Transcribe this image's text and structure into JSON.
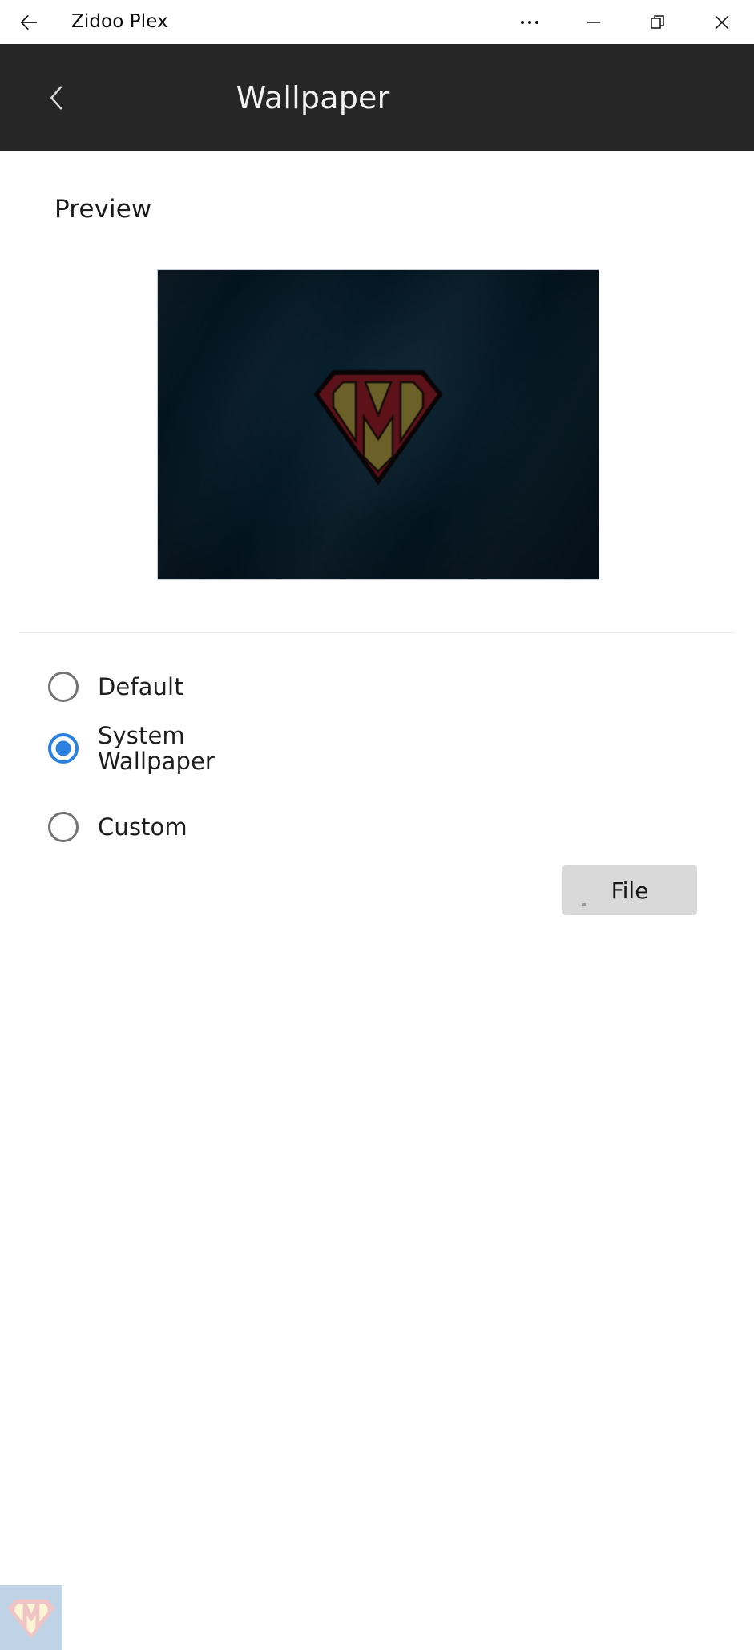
{
  "window": {
    "title": "Zidoo Plex",
    "back_icon": "arrow-left-icon",
    "controls": [
      {
        "name": "more-options-button",
        "glyph": "…",
        "label": "..."
      },
      {
        "name": "minimize-button",
        "glyph": "—",
        "label": "Minimize"
      },
      {
        "name": "restore-button",
        "glyph": "❐",
        "label": "Restore"
      },
      {
        "name": "close-button",
        "glyph": "✕",
        "label": "Close"
      }
    ]
  },
  "header": {
    "title": "Wallpaper",
    "back_icon": "chevron-left-icon",
    "background_color": "#262626",
    "text_color": "#f2f2f2"
  },
  "preview": {
    "label": "Preview",
    "image_alt": "wallpaper-preview-image",
    "background_color": "#04141e",
    "logo_shield_color": "#5c1218",
    "logo_letter_color": "#6b6027"
  },
  "options": {
    "selected": "system_wallpaper",
    "items": [
      {
        "id": "default",
        "label": "Default",
        "checked": false
      },
      {
        "id": "system_wallpaper",
        "label": "System\nWallpaper",
        "checked": true
      },
      {
        "id": "custom",
        "label": "Custom",
        "checked": false
      }
    ],
    "accent_color": "#2a81e0",
    "unchecked_color": "#737373"
  },
  "file_button": {
    "label": "File",
    "background_color": "#d9d9d9",
    "text_color": "#161616"
  },
  "watermark": {
    "alt": "app-shield-logo-watermark",
    "background_color": "#bed4e6",
    "shield_color": "#f0c3c4",
    "letter_color": "#fdf5d6"
  }
}
